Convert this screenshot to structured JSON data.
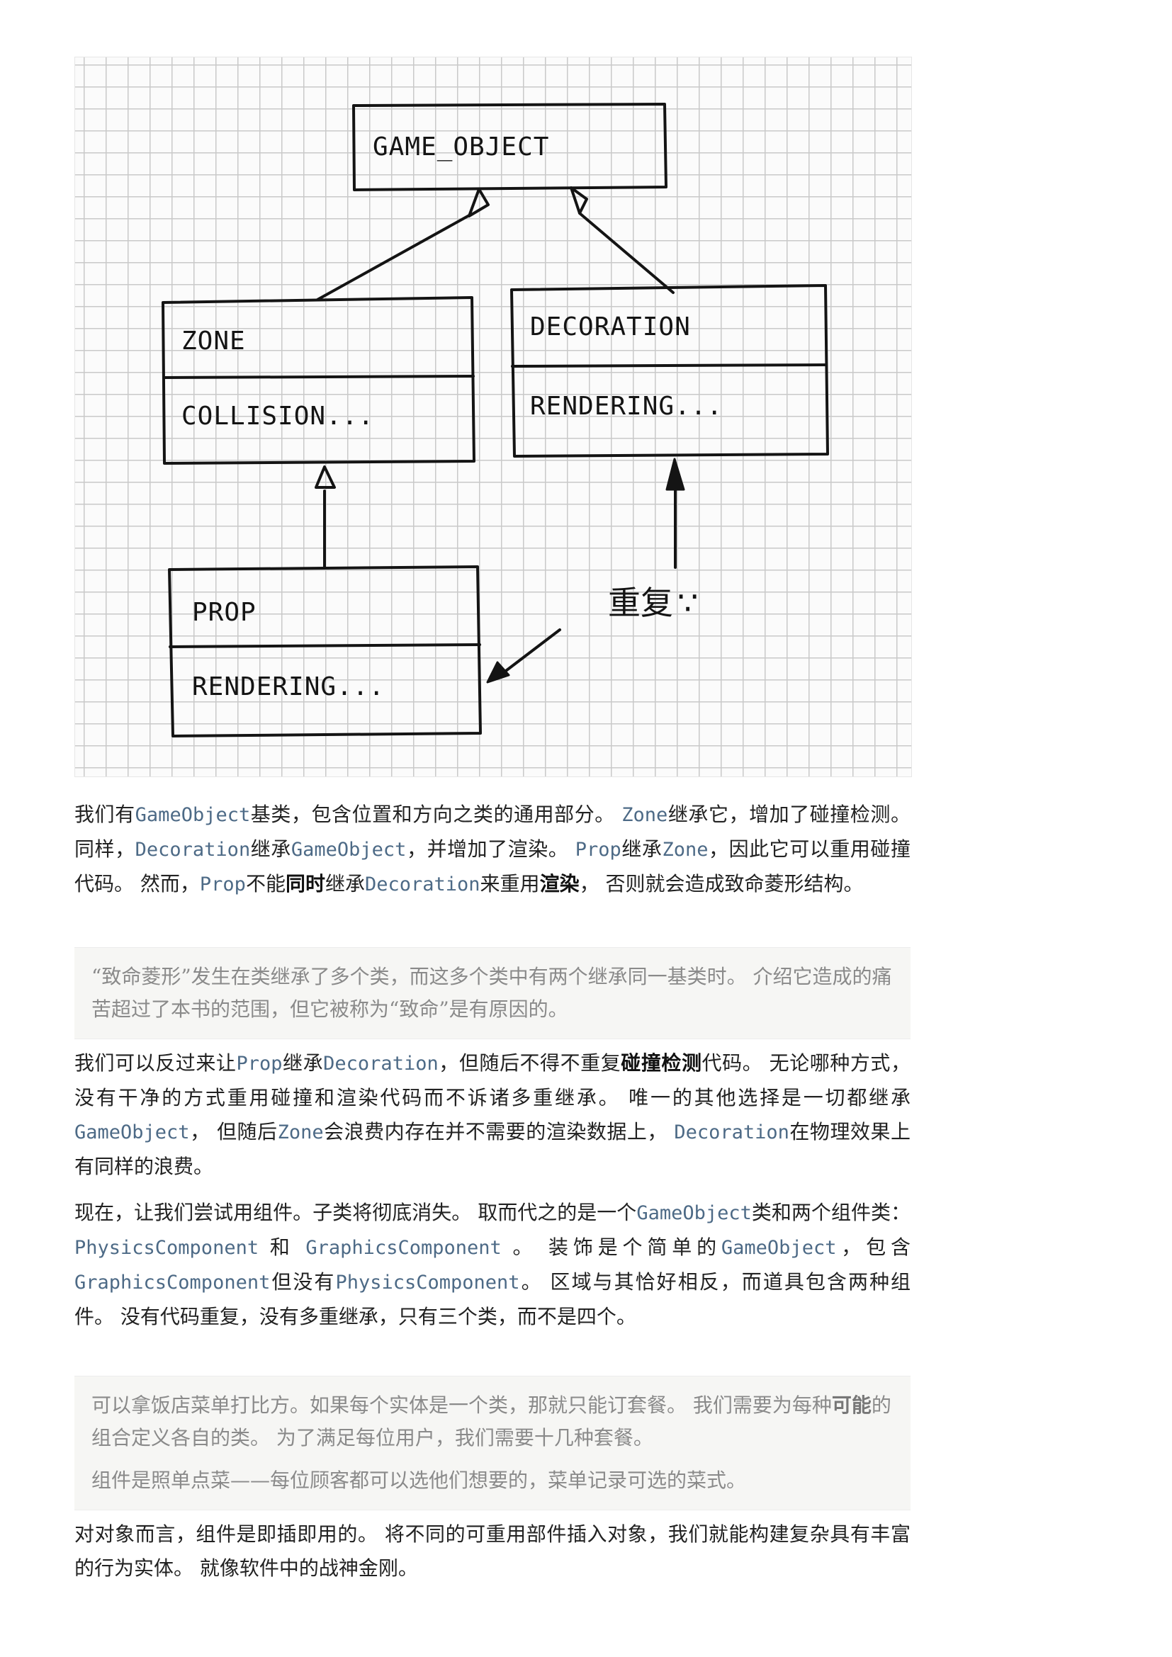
{
  "diagram": {
    "labels": {
      "game_object": "GAME_OBJECT",
      "zone": "ZONE",
      "zone_collision": "COLLISION...",
      "decoration": "DECORATION",
      "decoration_rendering": "RENDERING...",
      "prop": "PROP",
      "prop_rendering": "RENDERING...",
      "duplicate": "重复",
      "sad_face": "∵"
    }
  },
  "p1": {
    "s1": "我们有",
    "c1": "GameObject",
    "s2": "基类，包含位置和方向之类的通用部分。 ",
    "c2": "Zone",
    "s3": "继承它，增加了碰撞检测。 同样，",
    "c3": "Decoration",
    "s4": "继承",
    "c4": "GameObject",
    "s5": "，并增加了渲染。 ",
    "c5": "Prop",
    "s6": "继承",
    "c6": "Zone",
    "s7": "，因此它可以重用碰撞代码。 然而，",
    "c7": "Prop",
    "s8": "不能",
    "e1": "同时",
    "s9": "继承",
    "c8": "Decoration",
    "s10": "来重用",
    "e2": "渲染",
    "s11": "， 否则就会造成致命菱形结构。"
  },
  "note1": {
    "text": "“致命菱形”发生在类继承了多个类，而这多个类中有两个继承同一基类时。 介绍它造成的痛苦超过了本书的范围，但它被称为“致命”是有原因的。"
  },
  "p2": {
    "s1": "我们可以反过来让",
    "c1": "Prop",
    "s2": "继承",
    "c2": "Decoration",
    "s3": "，但随后不得不重复",
    "e1": "碰撞检测",
    "s4": "代码。 无论哪种方式，没有干净的方式重用碰撞和渲染代码而不诉诸多重继承。 唯一的其他选择是一切都继承",
    "c3": "GameObject",
    "s5": "， 但随后",
    "c4": "Zone",
    "s6": "会浪费内存在并不需要的渲染数据上， ",
    "c5": "Decoration",
    "s7": "在物理效果上有同样的浪费。"
  },
  "p3": {
    "s1": "现在，让我们尝试用组件。子类将彻底消失。 取而代之的是一个",
    "c1": "GameObject",
    "s2": "类和两个组件类： ",
    "c2": "PhysicsComponent",
    "s3": " 和 ",
    "c3": "GraphicsComponent",
    "s4": " 。 装饰是个简单的",
    "c4": "GameObject",
    "s5": "，包含",
    "c5": "GraphicsComponent",
    "s6": "但没有",
    "c6": "PhysicsComponent",
    "s7": "。 区域与其恰好相反，而道具包含两种组件。 没有代码重复，没有多重继承，只有三个类，而不是四个。"
  },
  "note2": {
    "line1_a": "可以拿饭店菜单打比方。如果每个实体是一个类，那就只能订套餐。 我们需要为每种",
    "line1_em": "可能",
    "line1_b": "的组合定义各自的类。 为了满足每位用户，我们需要十几种套餐。",
    "line2": "组件是照单点菜——每位顾客都可以选他们想要的，菜单记录可选的菜式。"
  },
  "p4": {
    "text": "对对象而言，组件是即插即用的。 将不同的可重用部件插入对象，我们就能构建复杂具有丰富的行为实体。 就像软件中的战神金刚。"
  }
}
